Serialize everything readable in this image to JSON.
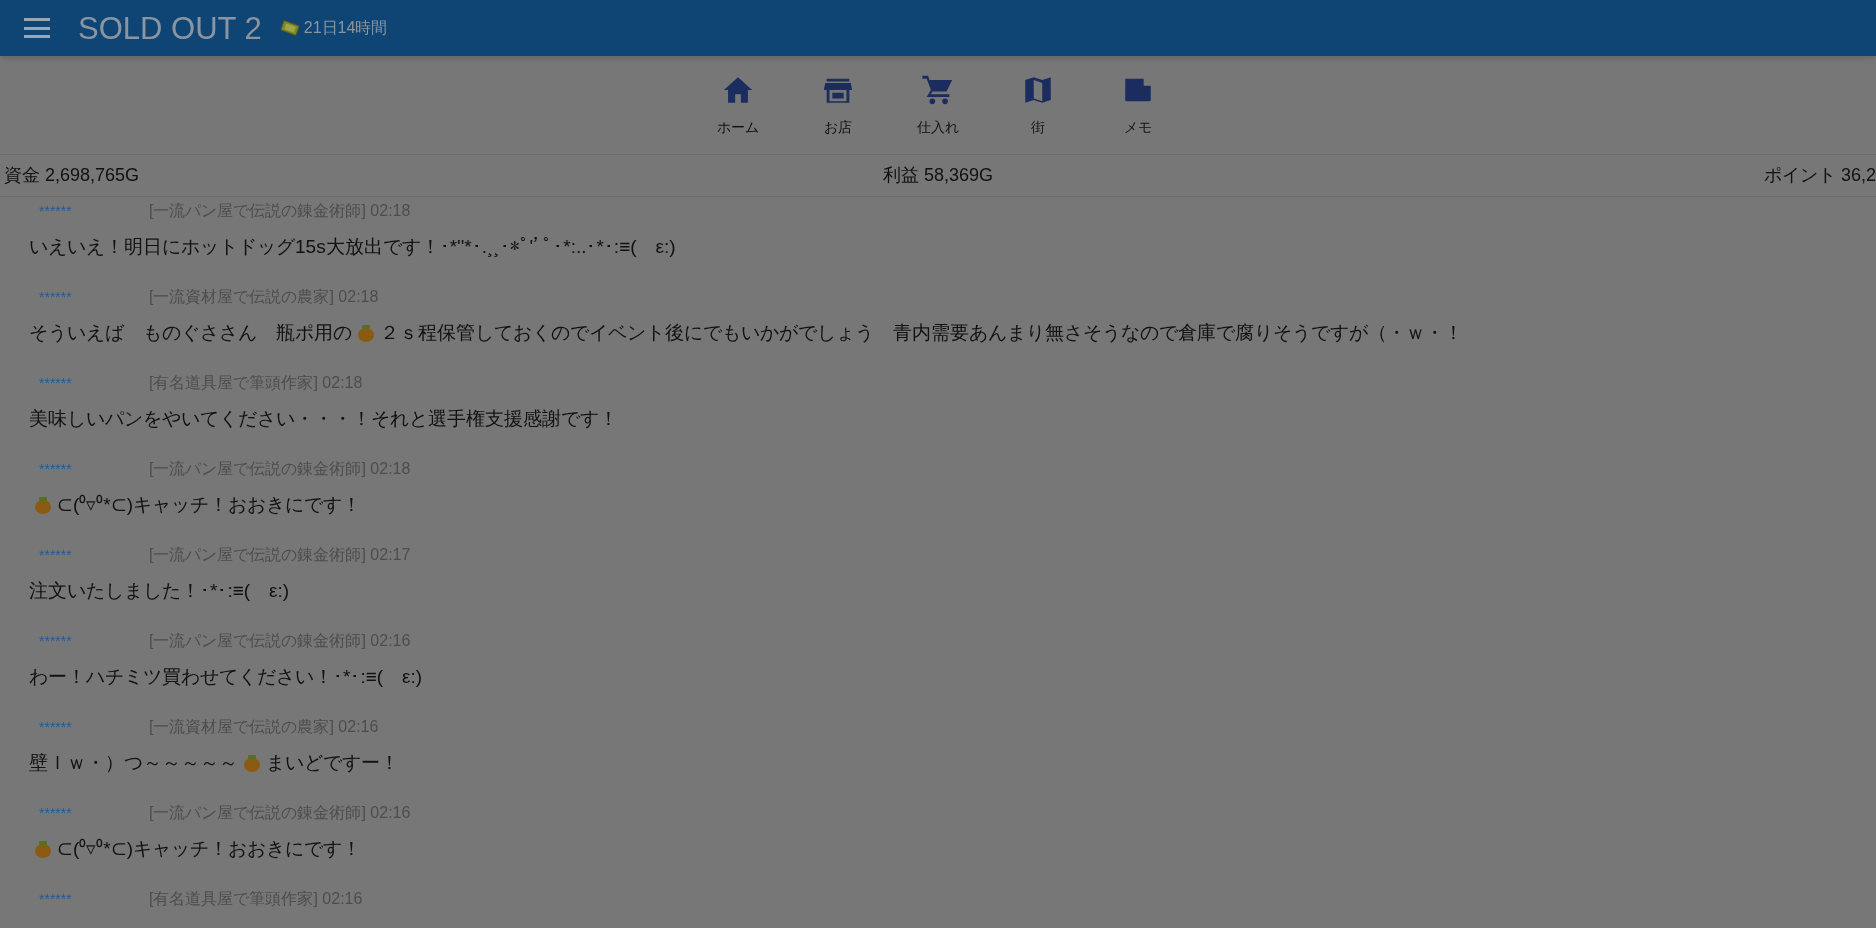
{
  "app_bar": {
    "title": "SOLD OUT 2",
    "time_left": "21日14時間"
  },
  "nav": [
    {
      "label": "ホーム"
    },
    {
      "label": "お店"
    },
    {
      "label": "仕入れ"
    },
    {
      "label": "街"
    },
    {
      "label": "メモ"
    }
  ],
  "stats": {
    "funds": "資金 2,698,765G",
    "profit": "利益 58,369G",
    "points": "ポイント 36,2"
  },
  "messages": [
    {
      "stars": "******",
      "author": "[一流パン屋で伝説の錬金術師] 02:18",
      "parts": [
        {
          "kind": "text",
          "text": "いえいえ！明日にホットドッグ15s大放出です！･*''*･.¸¸･*ﾟ''ﾟ･*:..･*･:≡(　ε:)"
        }
      ]
    },
    {
      "stars": "******",
      "author": "[一流資材屋で伝説の農家] 02:18",
      "parts": [
        {
          "kind": "text",
          "text": "そういえば　ものぐささん　瓶ポ用の"
        },
        {
          "kind": "icon"
        },
        {
          "kind": "text",
          "text": "２ｓ程保管しておくのでイベント後にでもいかがでしょう　青内需要あんまり無さそうなので倉庫で腐りそうですが（・ｗ・！"
        }
      ]
    },
    {
      "stars": "******",
      "author": "[有名道具屋で筆頭作家] 02:18",
      "parts": [
        {
          "kind": "text",
          "text": "美味しいパンをやいてください・・・！それと選手権支援感謝です！"
        }
      ]
    },
    {
      "stars": "******",
      "author": "[一流パン屋で伝説の錬金術師] 02:18",
      "parts": [
        {
          "kind": "icon"
        },
        {
          "kind": "text",
          "text": "⊂(⁰▿⁰*⊂)キャッチ！おおきにです！"
        }
      ]
    },
    {
      "stars": "******",
      "author": "[一流パン屋で伝説の錬金術師] 02:17",
      "parts": [
        {
          "kind": "text",
          "text": "注文いたしました！･*･:≡(　ε:)"
        }
      ]
    },
    {
      "stars": "******",
      "author": "[一流パン屋で伝説の錬金術師] 02:16",
      "parts": [
        {
          "kind": "text",
          "text": "わー！ハチミツ買わせてください！･*･:≡(　ε:)"
        }
      ]
    },
    {
      "stars": "******",
      "author": "[一流資材屋で伝説の農家] 02:16",
      "parts": [
        {
          "kind": "text",
          "text": "壁ｌｗ・）つ～～～～～"
        },
        {
          "kind": "icon"
        },
        {
          "kind": "text",
          "text": "まいどですー！"
        }
      ]
    },
    {
      "stars": "******",
      "author": "[一流パン屋で伝説の錬金術師] 02:16",
      "parts": [
        {
          "kind": "icon"
        },
        {
          "kind": "text",
          "text": "⊂(⁰▿⁰*⊂)キャッチ！おおきにです！"
        }
      ]
    },
    {
      "stars": "******",
      "author": "[有名道具屋で筆頭作家] 02:16"
    }
  ]
}
